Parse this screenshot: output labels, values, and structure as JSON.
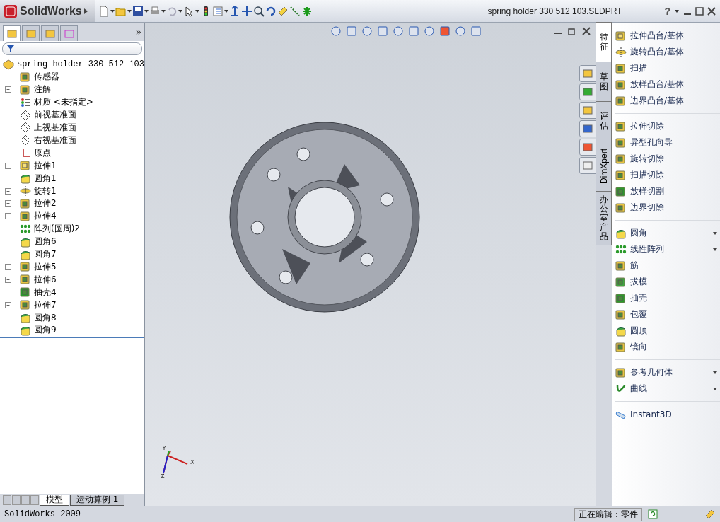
{
  "app": {
    "logo": "SolidWorks",
    "title": "spring holder 330 512 103.SLDPRT",
    "help": "?"
  },
  "left_tabs": [
    {
      "selected": true
    },
    {
      "selected": false
    },
    {
      "selected": false
    },
    {
      "selected": false
    }
  ],
  "left_more": "»",
  "tree": {
    "label": "spring holder 330 512 103",
    "children": [
      {
        "label": "传感器",
        "kind": "sensor",
        "expandable": false
      },
      {
        "label": "注解",
        "kind": "annotation",
        "expandable": true
      },
      {
        "label": "材质 <未指定>",
        "kind": "material",
        "expandable": false
      },
      {
        "label": "前视基准面",
        "kind": "plane",
        "expandable": false
      },
      {
        "label": "上视基准面",
        "kind": "plane",
        "expandable": false
      },
      {
        "label": "右视基准面",
        "kind": "plane",
        "expandable": false
      },
      {
        "label": "原点",
        "kind": "origin",
        "expandable": false
      },
      {
        "label": "拉伸1",
        "kind": "boss",
        "expandable": true
      },
      {
        "label": "圆角1",
        "kind": "fillet",
        "expandable": false
      },
      {
        "label": "旋转1",
        "kind": "revolve",
        "expandable": true
      },
      {
        "label": "拉伸2",
        "kind": "cut",
        "expandable": true
      },
      {
        "label": "拉伸4",
        "kind": "cut",
        "expandable": true
      },
      {
        "label": "阵列(圆周)2",
        "kind": "pattern",
        "expandable": false
      },
      {
        "label": "圆角6",
        "kind": "fillet",
        "expandable": false
      },
      {
        "label": "圆角7",
        "kind": "fillet",
        "expandable": false
      },
      {
        "label": "拉伸5",
        "kind": "cut",
        "expandable": true
      },
      {
        "label": "拉伸6",
        "kind": "cut",
        "expandable": true
      },
      {
        "label": "抽壳4",
        "kind": "shell",
        "expandable": false
      },
      {
        "label": "拉伸7",
        "kind": "cut",
        "expandable": true
      },
      {
        "label": "圆角8",
        "kind": "fillet",
        "expandable": false
      },
      {
        "label": "圆角9",
        "kind": "fillet",
        "expandable": false
      }
    ]
  },
  "bottom_tabs": [
    {
      "label": "模型",
      "selected": true
    },
    {
      "label": "运动算例 1",
      "selected": false
    }
  ],
  "triad": {
    "x": "X",
    "y": "Y",
    "z": "Z"
  },
  "side_tabs": [
    {
      "label": "特征",
      "kind": "cjk",
      "selected": true
    },
    {
      "label": "草图",
      "kind": "cjk",
      "selected": false
    },
    {
      "label": "评估",
      "kind": "cjk",
      "selected": false
    },
    {
      "label": "DimXpert",
      "kind": "latin",
      "selected": false
    },
    {
      "label": "办公室产品",
      "kind": "cjk",
      "selected": false
    }
  ],
  "commands": [
    [
      {
        "label": "拉伸凸台/基体",
        "kind": "boss",
        "has_menu": false
      },
      {
        "label": "旋转凸台/基体",
        "kind": "revolve",
        "has_menu": false
      },
      {
        "label": "扫描",
        "kind": "sweep",
        "has_menu": false
      },
      {
        "label": "放样凸台/基体",
        "kind": "loft",
        "has_menu": false
      },
      {
        "label": "边界凸台/基体",
        "kind": "boundary",
        "has_menu": false
      }
    ],
    [
      {
        "label": "拉伸切除",
        "kind": "cut",
        "has_menu": false
      },
      {
        "label": "异型孔向导",
        "kind": "hole",
        "has_menu": false
      },
      {
        "label": "旋转切除",
        "kind": "revcut",
        "has_menu": false
      },
      {
        "label": "扫描切除",
        "kind": "sweepcut",
        "has_menu": false
      },
      {
        "label": "放样切割",
        "kind": "loftcut",
        "has_menu": false
      },
      {
        "label": "边界切除",
        "kind": "boundcut",
        "has_menu": false
      }
    ],
    [
      {
        "label": "圆角",
        "kind": "fillet",
        "has_menu": true
      },
      {
        "label": "线性阵列",
        "kind": "pattern",
        "has_menu": true
      },
      {
        "label": "筋",
        "kind": "rib",
        "has_menu": false
      },
      {
        "label": "拔模",
        "kind": "draft",
        "has_menu": false
      },
      {
        "label": "抽壳",
        "kind": "shell",
        "has_menu": false
      },
      {
        "label": "包覆",
        "kind": "wrap",
        "has_menu": false
      },
      {
        "label": "圆顶",
        "kind": "dome",
        "has_menu": false
      },
      {
        "label": "镜向",
        "kind": "mirror",
        "has_menu": false
      }
    ],
    [
      {
        "label": "参考几何体",
        "kind": "refgeom",
        "has_menu": true
      },
      {
        "label": "曲线",
        "kind": "curve",
        "has_menu": true
      }
    ],
    [
      {
        "label": "Instant3D",
        "kind": "instant",
        "has_menu": false
      }
    ]
  ],
  "status_bar": {
    "app": "SolidWorks 2009",
    "mode": "正在编辑：零件"
  }
}
